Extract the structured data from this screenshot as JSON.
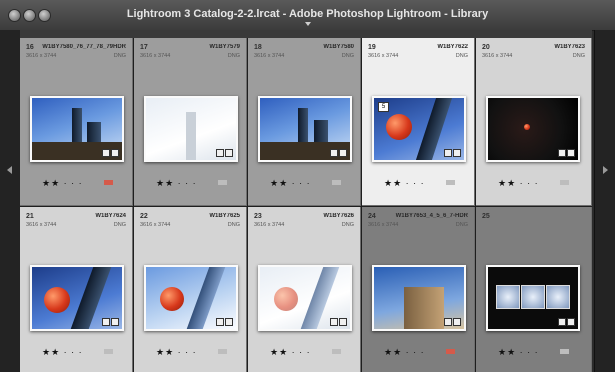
{
  "window": {
    "title": "Lightroom 3 Catalog-2-2.lrcat - Adobe Photoshop Lightroom - Library"
  },
  "cells": [
    {
      "num": "16",
      "name": "W1BY7580_76_77_78_79HDR",
      "dims": "3616 x 3744",
      "ext": "DNG",
      "stars": "★★ · · ·",
      "label": "red"
    },
    {
      "num": "17",
      "name": "W1BY7579",
      "dims": "3616 x 3744",
      "ext": "DNG",
      "stars": "★★ · · ·",
      "label": "none"
    },
    {
      "num": "18",
      "name": "W1BY7580",
      "dims": "3616 x 3744",
      "ext": "DNG",
      "stars": "★★ · · ·",
      "label": "none"
    },
    {
      "num": "19",
      "name": "W1BY7622",
      "dims": "3616 x 3744",
      "ext": "DNG",
      "stars": "★★ · · ·",
      "label": "none",
      "tag": "5"
    },
    {
      "num": "20",
      "name": "W1BY7623",
      "dims": "3616 x 3744",
      "ext": "DNG",
      "stars": "★★ · · ·",
      "label": "none"
    },
    {
      "num": "21",
      "name": "W1BY7624",
      "dims": "3616 x 3744",
      "ext": "DNG",
      "stars": "★★ · · ·",
      "label": "none"
    },
    {
      "num": "22",
      "name": "W1BY7625",
      "dims": "3616 x 3744",
      "ext": "DNG",
      "stars": "★★ · · ·",
      "label": "none"
    },
    {
      "num": "23",
      "name": "W1BY7626",
      "dims": "3616 x 3744",
      "ext": "DNG",
      "stars": "★★ · · ·",
      "label": "none"
    },
    {
      "num": "24",
      "name": "W1BY7653_4_5_6_7-HDR",
      "dims": "3616 x 3744",
      "ext": "DNG",
      "stars": "★★ · · ·",
      "label": "red"
    },
    {
      "num": "25",
      "name": "",
      "dims": "",
      "ext": "",
      "stars": "★★ · · ·",
      "label": "none"
    }
  ]
}
